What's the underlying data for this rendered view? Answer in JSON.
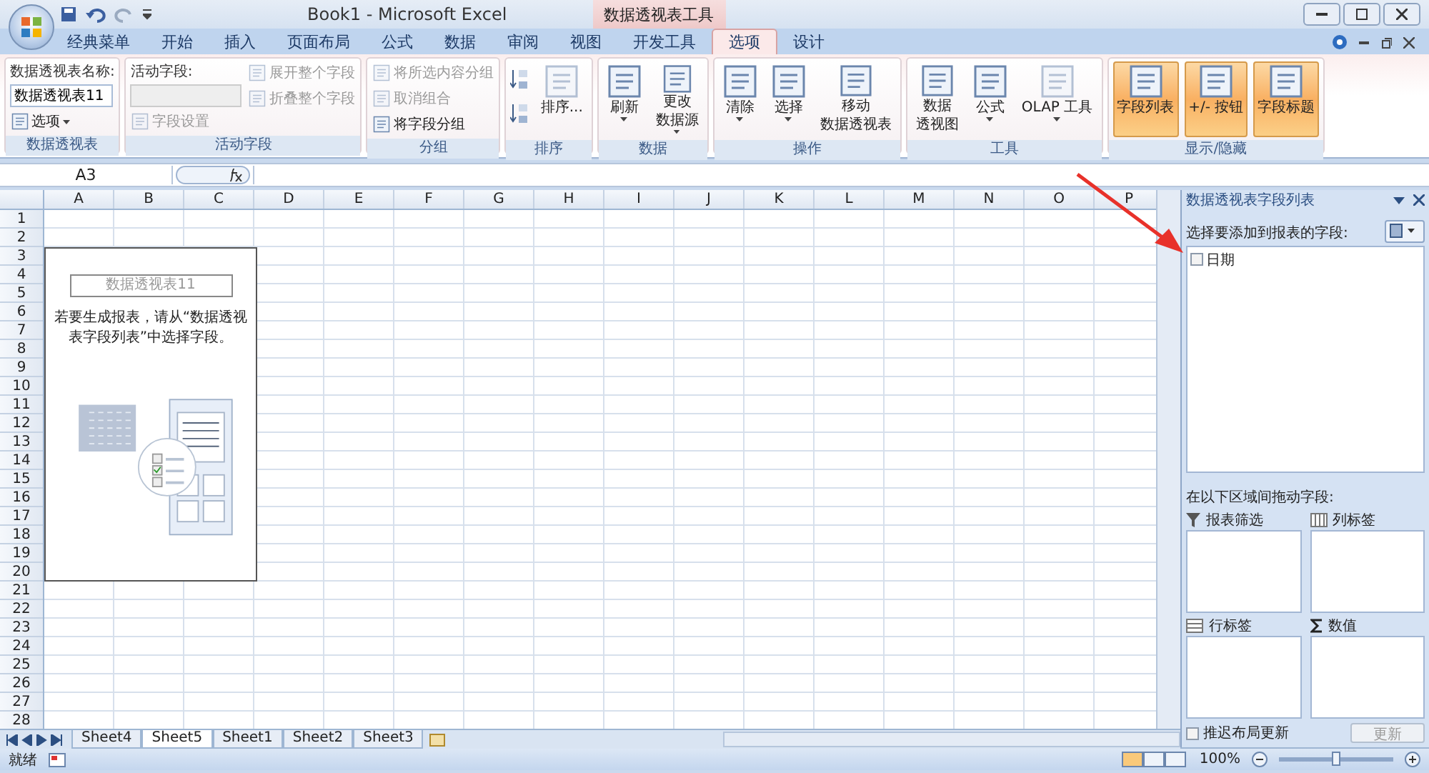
{
  "window": {
    "title": "Book1 - Microsoft Excel",
    "context_group": "数据透视表工具"
  },
  "ribbon_tabs": [
    {
      "label": "经典菜单",
      "selected": false
    },
    {
      "label": "开始",
      "selected": false
    },
    {
      "label": "插入",
      "selected": false
    },
    {
      "label": "页面布局",
      "selected": false
    },
    {
      "label": "公式",
      "selected": false
    },
    {
      "label": "数据",
      "selected": false
    },
    {
      "label": "审阅",
      "selected": false
    },
    {
      "label": "视图",
      "selected": false
    },
    {
      "label": "开发工具",
      "selected": false
    },
    {
      "label": "选项",
      "selected": true
    },
    {
      "label": "设计",
      "selected": false
    }
  ],
  "ribbon_groups": [
    {
      "label": "数据透视表",
      "columns": [
        [
          {
            "kind": "label",
            "label": "数据透视表名称:",
            "disabled": false
          },
          {
            "kind": "field",
            "value": "数据透视表11",
            "disabled": false
          },
          {
            "kind": "small",
            "label": "选项",
            "dropdown": true,
            "disabled": false
          }
        ]
      ]
    },
    {
      "label": "活动字段",
      "columns": [
        [
          {
            "kind": "label",
            "label": "活动字段:",
            "disabled": false
          },
          {
            "kind": "field",
            "disabled": true
          },
          {
            "kind": "small",
            "label": "字段设置",
            "disabled": true
          }
        ],
        [
          {
            "kind": "small",
            "label": "展开整个字段",
            "disabled": true
          },
          {
            "kind": "small",
            "label": "折叠整个字段",
            "disabled": true
          }
        ]
      ]
    },
    {
      "label": "分组",
      "columns": [
        [
          {
            "kind": "small",
            "label": "将所选内容分组",
            "disabled": true
          },
          {
            "kind": "small",
            "label": "取消组合",
            "disabled": true
          },
          {
            "kind": "small",
            "label": "将字段分组",
            "disabled": false
          }
        ]
      ]
    },
    {
      "label": "排序",
      "columns": [
        [
          {
            "kind": "icon",
            "disabled": false
          },
          {
            "kind": "icon",
            "disabled": false
          }
        ],
        [
          {
            "kind": "large",
            "label": "排序...",
            "disabled": true
          }
        ]
      ]
    },
    {
      "label": "数据",
      "columns": [
        [
          {
            "kind": "large",
            "label": "刷新",
            "dropdown": true,
            "disabled": false
          }
        ],
        [
          {
            "kind": "large",
            "lines": [
              "更改",
              "数据源"
            ],
            "dropdown": true,
            "disabled": false
          }
        ]
      ]
    },
    {
      "label": "操作",
      "columns": [
        [
          {
            "kind": "large",
            "label": "清除",
            "dropdown": true,
            "disabled": false
          }
        ],
        [
          {
            "kind": "large",
            "label": "选择",
            "dropdown": true,
            "disabled": false
          }
        ],
        [
          {
            "kind": "large",
            "lines": [
              "移动",
              "数据透视表"
            ],
            "disabled": false
          }
        ]
      ]
    },
    {
      "label": "工具",
      "columns": [
        [
          {
            "kind": "large",
            "lines": [
              "数据",
              "透视图"
            ],
            "disabled": false
          }
        ],
        [
          {
            "kind": "large",
            "label": "公式",
            "dropdown": true,
            "disabled": false
          }
        ],
        [
          {
            "kind": "large",
            "label": "OLAP 工具",
            "dropdown": true,
            "disabled": true
          }
        ]
      ]
    },
    {
      "label": "显示/隐藏",
      "columns": [
        [
          {
            "kind": "large",
            "label": "字段列表",
            "on": true,
            "disabled": false
          }
        ],
        [
          {
            "kind": "large",
            "label": "+/- 按钮",
            "on": true,
            "disabled": false
          }
        ],
        [
          {
            "kind": "large",
            "label": "字段标题",
            "on": true,
            "disabled": false
          }
        ]
      ]
    }
  ],
  "formula_bar": {
    "name_box": "A3"
  },
  "columns": [
    "A",
    "B",
    "C",
    "D",
    "E",
    "F",
    "G",
    "H",
    "I",
    "J",
    "K",
    "L",
    "M",
    "N",
    "O",
    "P"
  ],
  "rows": [
    "1",
    "2",
    "3",
    "4",
    "5",
    "6",
    "7",
    "8",
    "9",
    "10",
    "11",
    "12",
    "13",
    "14",
    "15",
    "16",
    "17",
    "18",
    "19",
    "20",
    "21",
    "22",
    "23",
    "24",
    "25",
    "26",
    "27",
    "28"
  ],
  "pivot_placeholder": {
    "title": "数据透视表11",
    "message": "若要生成报表，请从“数据透视表字段列表”中选择字段。"
  },
  "sheet_tabs": [
    {
      "label": "Sheet4",
      "selected": false
    },
    {
      "label": "Sheet5",
      "selected": true
    },
    {
      "label": "Sheet1",
      "selected": false
    },
    {
      "label": "Sheet2",
      "selected": false
    },
    {
      "label": "Sheet3",
      "selected": false
    }
  ],
  "field_list": {
    "title": "数据透视表字段列表",
    "prompt": "选择要添加到报表的字段:",
    "fields": [
      {
        "label": "日期",
        "checked": false
      }
    ],
    "areas_prompt": "在以下区域间拖动字段:",
    "areas": [
      {
        "kind": "filter",
        "label": "报表筛选"
      },
      {
        "kind": "columns",
        "label": "列标签"
      },
      {
        "kind": "rows",
        "label": "行标签"
      },
      {
        "kind": "values",
        "label": "数值"
      }
    ],
    "defer": {
      "label": "推迟布局更新",
      "checked": false
    },
    "update_button": {
      "label": "更新",
      "disabled": true
    }
  },
  "status_bar": {
    "text": "就绪",
    "zoom": "100%",
    "zoom_slider": {
      "level": 0.5
    }
  }
}
